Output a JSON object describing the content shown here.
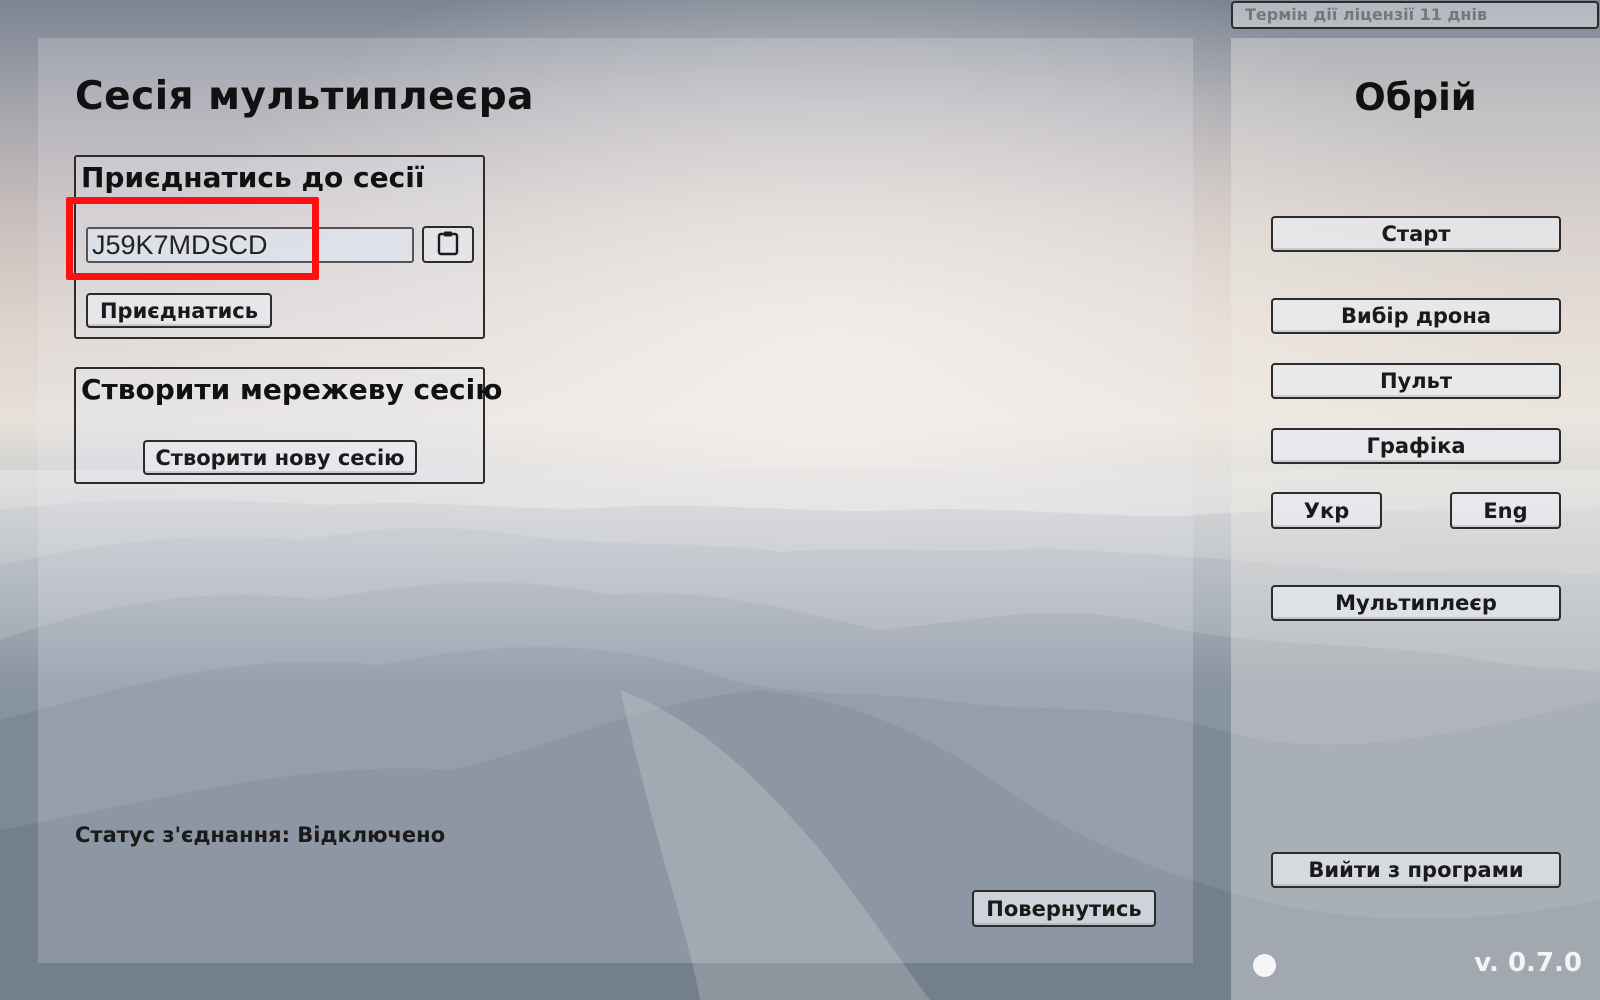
{
  "license": {
    "text": "Термін дії ліцензії 11 днів"
  },
  "multiplayer": {
    "title": "Сесія мультиплеєра",
    "join": {
      "title": "Приєднатись до сесії",
      "session_code": "J59K7MDSCD",
      "paste_icon": "clipboard-icon",
      "join_label": "Приєднатись"
    },
    "create": {
      "title": "Створити мережеву сесію",
      "create_label": "Створити нову сесію"
    },
    "status": "Статус з'єднання: Відключено",
    "back_label": "Повернутись"
  },
  "sidebar": {
    "app_title": "Обрій",
    "menu": [
      {
        "label": "Старт"
      },
      {
        "label": "Вибір дрона"
      },
      {
        "label": "Пульт"
      },
      {
        "label": "Графіка"
      }
    ],
    "languages": [
      {
        "label": "Укр"
      },
      {
        "label": "Eng"
      }
    ],
    "multiplayer_label": "Мультиплеєр",
    "exit_label": "Вийти з програми",
    "version": "v. 0.7.0"
  },
  "colors": {
    "highlight": "#ff1010",
    "panel_border": "#2c2c2c",
    "text": "#111111"
  }
}
